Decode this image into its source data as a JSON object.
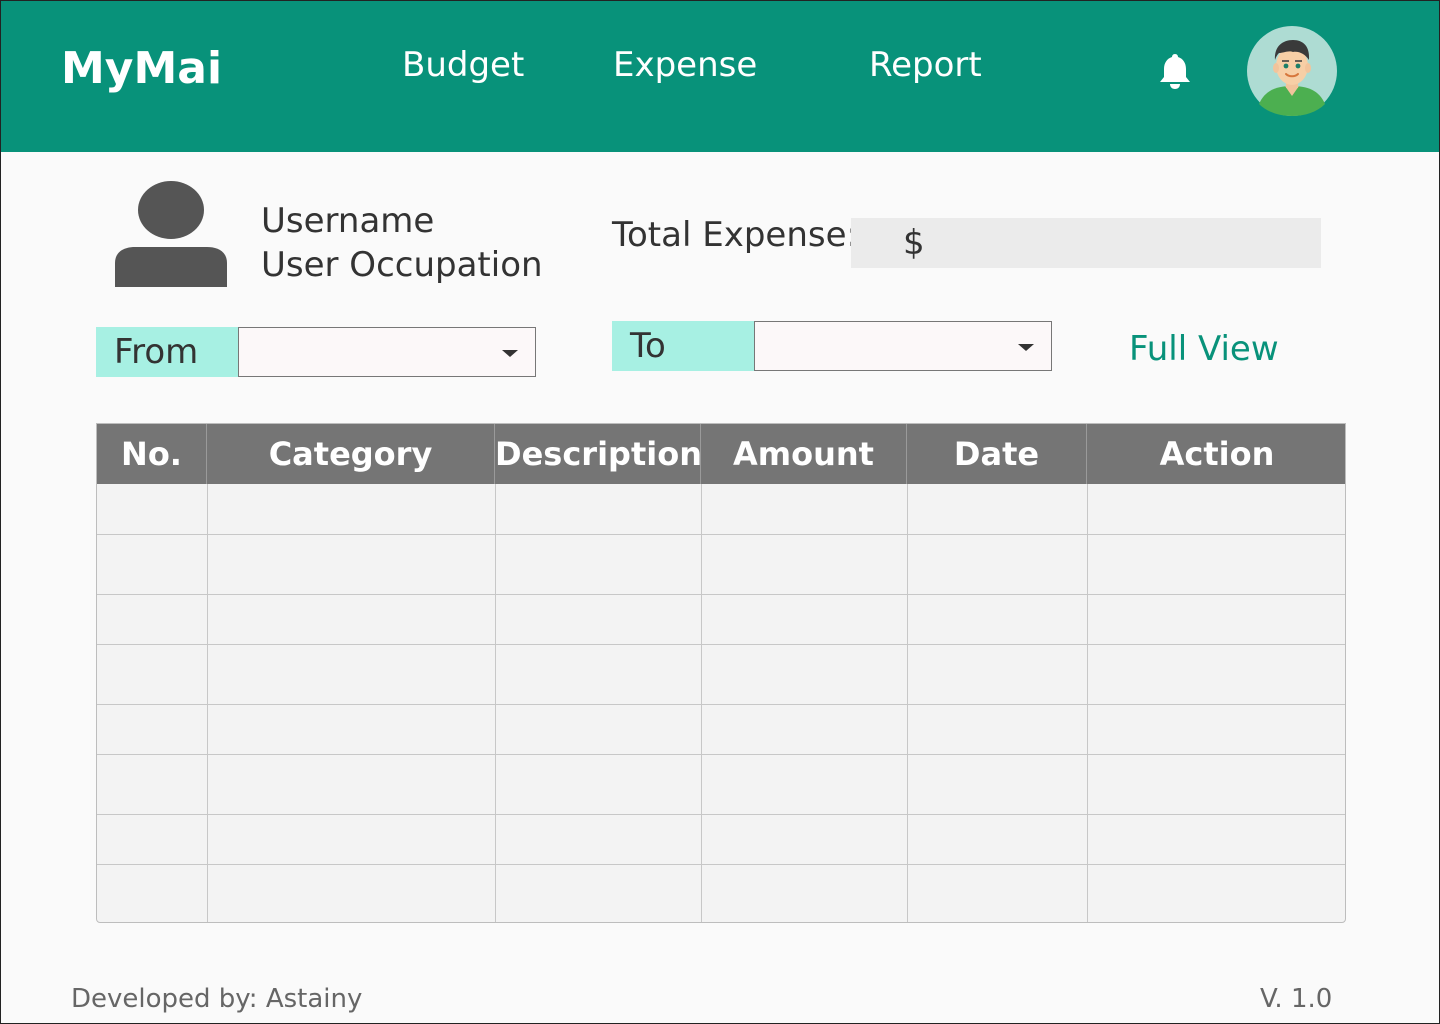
{
  "header": {
    "logo": "MyMai",
    "nav": [
      "Budget",
      "Expense",
      "Report"
    ]
  },
  "user": {
    "name": "Username",
    "occupation": "User Occupation"
  },
  "summary": {
    "total_label": "Total Expense:",
    "total_value": "$"
  },
  "filters": {
    "from_label": "From",
    "from_value": "",
    "to_label": "To",
    "to_value": "",
    "full_view": "Full View"
  },
  "table": {
    "columns": [
      "No.",
      "Category",
      "Description",
      "Amount",
      "Date",
      "Action"
    ],
    "rows": [
      [
        "",
        "",
        "",
        "",
        "",
        ""
      ],
      [
        "",
        "",
        "",
        "",
        "",
        ""
      ],
      [
        "",
        "",
        "",
        "",
        "",
        ""
      ],
      [
        "",
        "",
        "",
        "",
        "",
        ""
      ],
      [
        "",
        "",
        "",
        "",
        "",
        ""
      ],
      [
        "",
        "",
        "",
        "",
        "",
        ""
      ],
      [
        "",
        "",
        "",
        "",
        "",
        ""
      ],
      [
        "",
        "",
        "",
        "",
        "",
        ""
      ]
    ]
  },
  "footer": {
    "developer": "Developed by: Astainy",
    "version": "V. 1.0"
  },
  "icons": {
    "bell": "bell-icon",
    "avatar": "user-avatar",
    "user": "user-silhouette-icon"
  },
  "colors": {
    "primary": "#08927a",
    "label_bg": "#a7f0e3",
    "table_header": "#757575"
  }
}
